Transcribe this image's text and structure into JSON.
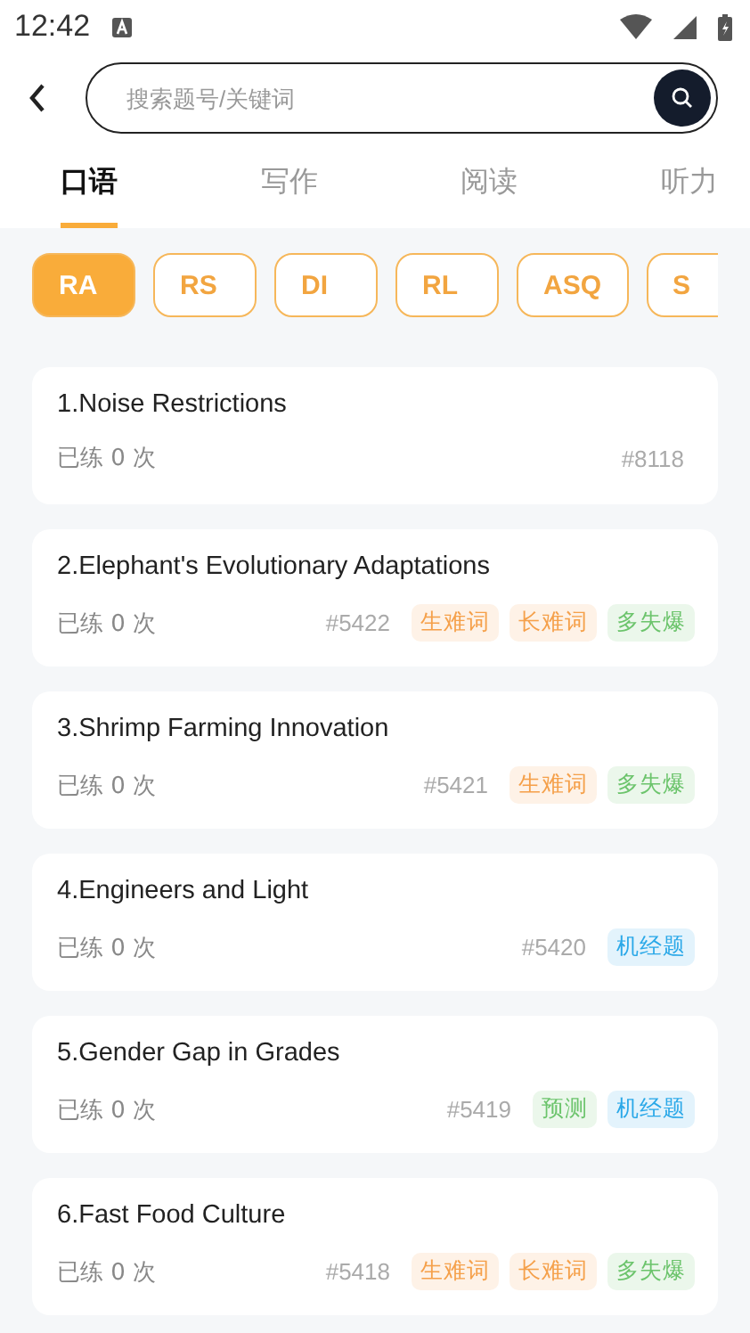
{
  "status_bar": {
    "time": "12:42"
  },
  "search": {
    "placeholder": "搜索题号/关键词"
  },
  "tabs": [
    {
      "label": "口语",
      "selected": true
    },
    {
      "label": "写作",
      "selected": false
    },
    {
      "label": "阅读",
      "selected": false
    },
    {
      "label": "听力",
      "selected": false
    }
  ],
  "chips": [
    {
      "label": "RA",
      "selected": true
    },
    {
      "label": "RS",
      "selected": false
    },
    {
      "label": "DI",
      "selected": false
    },
    {
      "label": "RL",
      "selected": false
    },
    {
      "label": "ASQ",
      "selected": false
    },
    {
      "label": "S",
      "selected": false
    }
  ],
  "questions": [
    {
      "title": "1.Noise Restrictions",
      "practice": "已练 0 次",
      "id": "#8118"
    },
    {
      "title": "2.Elephant's Evolutionary Adaptations",
      "practice": "已练 0 次",
      "id": "#5422",
      "tags": [
        {
          "label": "生难词",
          "color": "#f5a04a"
        },
        {
          "label": "长难词",
          "color": "#f5a04a"
        },
        {
          "label": "多失爆",
          "color": "#6cc46c"
        }
      ]
    },
    {
      "title": "3.Shrimp Farming Innovation",
      "practice": "已练 0 次",
      "id": "#5421",
      "tags": [
        {
          "label": "生难词",
          "color": "#f5a04a"
        },
        {
          "label": "多失爆",
          "color": "#6cc46c"
        }
      ]
    },
    {
      "title": "4.Engineers and Light",
      "practice": "已练 0 次",
      "id": "#5420",
      "tags": [
        {
          "label": "机经题",
          "color": "#2aa8e8"
        }
      ]
    },
    {
      "title": "5.Gender Gap in Grades",
      "practice": "已练 0 次",
      "id": "#5419",
      "tags": [
        {
          "label": "预测",
          "color": "#6cc46c"
        },
        {
          "label": "机经题",
          "color": "#2aa8e8"
        }
      ]
    },
    {
      "title": "6.Fast Food Culture",
      "practice": "已练 0 次",
      "id": "#5418",
      "tags": [
        {
          "label": "生难词",
          "color": "#f5a04a"
        },
        {
          "label": "长难词",
          "color": "#f5a04a"
        },
        {
          "label": "多失爆",
          "color": "#6cc46c"
        }
      ]
    }
  ]
}
